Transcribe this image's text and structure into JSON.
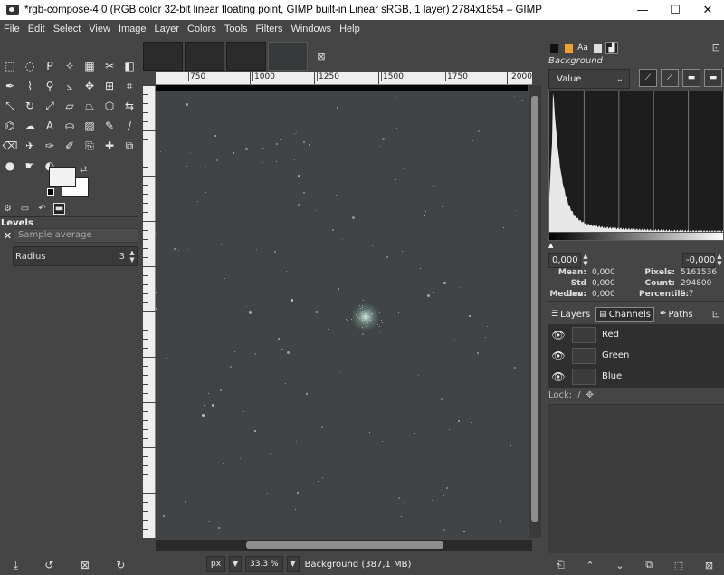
{
  "window": {
    "title": "*rgb-compose-4.0 (RGB color 32-bit linear floating point, GIMP built-in Linear sRGB, 1 layer) 2784x1854 – GIMP",
    "minimize": "—",
    "maximize": "☐",
    "close": "✕"
  },
  "menu": [
    "File",
    "Edit",
    "Select",
    "View",
    "Image",
    "Layer",
    "Colors",
    "Tools",
    "Filters",
    "Windows",
    "Help"
  ],
  "toolbox": {
    "tools": [
      {
        "icon": "rect-select-icon",
        "glyph": "⬚"
      },
      {
        "icon": "ellipse-select-icon",
        "glyph": "◌"
      },
      {
        "icon": "lasso-icon",
        "glyph": "ᑭ"
      },
      {
        "icon": "fuzzy-select-icon",
        "glyph": "✧"
      },
      {
        "icon": "select-by-color-icon",
        "glyph": "▦"
      },
      {
        "icon": "scissors-icon",
        "glyph": "✂"
      },
      {
        "icon": "foreground-select-icon",
        "glyph": "◧"
      },
      {
        "icon": "paths-icon",
        "glyph": "✒"
      },
      {
        "icon": "color-picker-icon",
        "glyph": "⌇"
      },
      {
        "icon": "zoom-icon",
        "glyph": "⚲"
      },
      {
        "icon": "measure-icon",
        "glyph": "⦣"
      },
      {
        "icon": "move-icon",
        "glyph": "✥"
      },
      {
        "icon": "align-icon",
        "glyph": "⊞"
      },
      {
        "icon": "crop-icon",
        "glyph": "⌗"
      },
      {
        "icon": "unified-transform-icon",
        "glyph": "⤡"
      },
      {
        "icon": "rotate-icon",
        "glyph": "↻"
      },
      {
        "icon": "scale-icon",
        "glyph": "⤢"
      },
      {
        "icon": "shear-icon",
        "glyph": "▱"
      },
      {
        "icon": "perspective-icon",
        "glyph": "⏢"
      },
      {
        "icon": "3d-transform-icon",
        "glyph": "⬡"
      },
      {
        "icon": "flip-icon",
        "glyph": "⇆"
      },
      {
        "icon": "cage-icon",
        "glyph": "⌬"
      },
      {
        "icon": "warp-icon",
        "glyph": "☁"
      },
      {
        "icon": "text-icon",
        "glyph": "A"
      },
      {
        "icon": "bucket-fill-icon",
        "glyph": "⛀"
      },
      {
        "icon": "gradient-icon",
        "glyph": "▨"
      },
      {
        "icon": "pencil-icon",
        "glyph": "✎"
      },
      {
        "icon": "paintbrush-icon",
        "glyph": "∕"
      },
      {
        "icon": "eraser-icon",
        "glyph": "⌫"
      },
      {
        "icon": "airbrush-icon",
        "glyph": "✈"
      },
      {
        "icon": "ink-icon",
        "glyph": "✑"
      },
      {
        "icon": "mypaint-brush-icon",
        "glyph": "✐"
      },
      {
        "icon": "clone-icon",
        "glyph": "⎘"
      },
      {
        "icon": "heal-icon",
        "glyph": "✚"
      },
      {
        "icon": "perspective-clone-icon",
        "glyph": "⧉"
      },
      {
        "icon": "blur-icon",
        "glyph": "●"
      },
      {
        "icon": "smudge-icon",
        "glyph": "☛"
      },
      {
        "icon": "dodge-burn-icon",
        "glyph": "◐"
      }
    ],
    "dock_tabs": [
      {
        "icon": "tool-options-icon",
        "glyph": "⚙"
      },
      {
        "icon": "device-status-icon",
        "glyph": "▭"
      },
      {
        "icon": "undo-history-icon",
        "glyph": "↶"
      },
      {
        "icon": "images-icon",
        "glyph": "▬"
      }
    ],
    "options_title": "Levels",
    "sample_label": "Sample average",
    "radius_label": "Radius",
    "radius_value": "3",
    "bottom_icons": [
      {
        "icon": "save-options-icon",
        "glyph": "⤓"
      },
      {
        "icon": "restore-options-icon",
        "glyph": "↺"
      },
      {
        "icon": "delete-options-icon",
        "glyph": "⊠"
      },
      {
        "icon": "reset-options-icon",
        "glyph": "↻"
      }
    ]
  },
  "canvas": {
    "ruler_ticks": [
      "|750",
      "|1000",
      "|1250",
      "|1500",
      "|1750",
      "|2000"
    ],
    "close_glyph": "⊠",
    "zoom_unit": "px",
    "zoom_value": "33.3 %",
    "status_text": "Background (387,1 MB)"
  },
  "dock": {
    "tabs": [
      {
        "icon": "fg-bg-color-icon",
        "glyph": "■",
        "color": "#111111"
      },
      {
        "icon": "pattern-icon",
        "glyph": "■",
        "color": "#f0a030"
      },
      {
        "icon": "font-icon",
        "glyph": "Aa",
        "color": ""
      },
      {
        "icon": "document-history-icon",
        "glyph": "▮",
        "color": "#dddddd"
      },
      {
        "icon": "histogram-tab-icon",
        "glyph": "▟",
        "color": ""
      }
    ],
    "close_glyph": "⊡",
    "histogram_title": "Background",
    "channel": "Value",
    "range_low": "0,000",
    "range_high": "-0,000",
    "stats": {
      "mean_label": "Mean:",
      "mean": "0,000",
      "stddev_label": "Std dev:",
      "stddev": "0,000",
      "median_label": "Median:",
      "median": "0,000",
      "pixels_label": "Pixels:",
      "pixels": "5161536",
      "count_label": "Count:",
      "count": "294800",
      "percentile_label": "Percentile:",
      "percentile": "5.7"
    },
    "lc_tabs": [
      {
        "label": "Layers",
        "icon": "layers-icon",
        "glyph": "☰"
      },
      {
        "label": "Channels",
        "icon": "channels-icon",
        "glyph": "▤"
      },
      {
        "label": "Paths",
        "icon": "paths-tab-icon",
        "glyph": "✒"
      }
    ],
    "channels": [
      "Red",
      "Green",
      "Blue"
    ],
    "lock_label": "Lock:",
    "bottom_icons": [
      {
        "icon": "new-channel-icon",
        "glyph": "⎗"
      },
      {
        "icon": "raise-channel-icon",
        "glyph": "⌃"
      },
      {
        "icon": "lower-channel-icon",
        "glyph": "⌄"
      },
      {
        "icon": "duplicate-channel-icon",
        "glyph": "⧉"
      },
      {
        "icon": "channel-to-selection-icon",
        "glyph": "⬚"
      },
      {
        "icon": "delete-channel-icon",
        "glyph": "⊠"
      }
    ]
  }
}
